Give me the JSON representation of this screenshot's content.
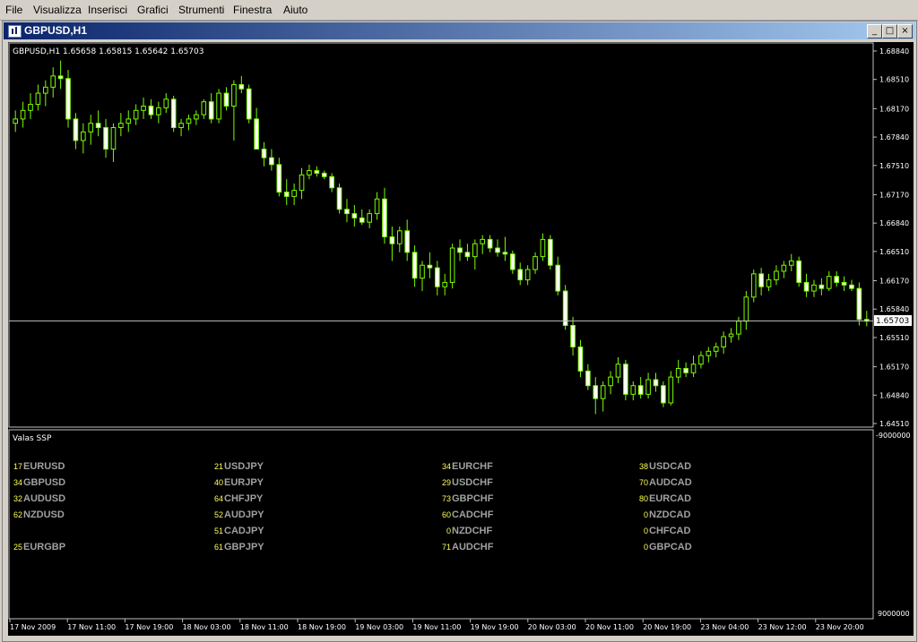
{
  "menu": {
    "items": [
      "File",
      "Visualizza",
      "Inserisci",
      "Grafici",
      "Strumenti",
      "Finestra",
      "Aiuto"
    ]
  },
  "window": {
    "title": "GBPUSD,H1",
    "icon": "chart-window-icon",
    "buttons": {
      "minimize": "_",
      "restore": "□",
      "close": "×"
    }
  },
  "chart": {
    "header": "GBPUSD,H1  1.65658 1.65815 1.65642 1.65703",
    "current_price_label": "1.65703",
    "price_ticks": [
      "1.68840",
      "1.68510",
      "1.68170",
      "1.67840",
      "1.67510",
      "1.67170",
      "1.66840",
      "1.66510",
      "1.66170",
      "1.65840",
      "1.65510",
      "1.65170",
      "1.64840",
      "1.64510"
    ],
    "time_ticks": [
      "17 Nov 2009",
      "17 Nov 11:00",
      "17 Nov 19:00",
      "18 Nov 03:00",
      "18 Nov 11:00",
      "18 Nov 19:00",
      "19 Nov 03:00",
      "19 Nov 11:00",
      "19 Nov 19:00",
      "20 Nov 03:00",
      "20 Nov 11:00",
      "20 Nov 19:00",
      "23 Nov 04:00",
      "23 Nov 12:00",
      "23 Nov 20:00"
    ],
    "colors": {
      "background": "#000000",
      "bull": "#7cfc00",
      "bear": "#ffffff",
      "grid": "#c0c0c0",
      "text": "#ffffff"
    }
  },
  "indicator": {
    "name": "Valas SSP",
    "scale_top": "-9000000",
    "scale_bottom": "9000000",
    "colors": {
      "value": "#ffff55",
      "pair": "#a0a0a0"
    },
    "columns": [
      [
        {
          "value": "17",
          "pair": "EURUSD"
        },
        {
          "value": "34",
          "pair": "GBPUSD"
        },
        {
          "value": "32",
          "pair": "AUDUSD"
        },
        {
          "value": "62",
          "pair": "NZDUSD"
        },
        {
          "value": "",
          "pair": ""
        },
        {
          "value": "25",
          "pair": "EURGBP"
        }
      ],
      [
        {
          "value": "21",
          "pair": "USDJPY"
        },
        {
          "value": "40",
          "pair": "EURJPY"
        },
        {
          "value": "64",
          "pair": "CHFJPY"
        },
        {
          "value": "52",
          "pair": "AUDJPY"
        },
        {
          "value": "51",
          "pair": "CADJPY"
        },
        {
          "value": "61",
          "pair": "GBPJPY"
        }
      ],
      [
        {
          "value": "34",
          "pair": "EURCHF"
        },
        {
          "value": "29",
          "pair": "USDCHF"
        },
        {
          "value": "73",
          "pair": "GBPCHF"
        },
        {
          "value": "60",
          "pair": "CADCHF"
        },
        {
          "value": "0",
          "pair": "NZDCHF"
        },
        {
          "value": "71",
          "pair": "AUDCHF"
        }
      ],
      [
        {
          "value": "38",
          "pair": "USDCAD"
        },
        {
          "value": "70",
          "pair": "AUDCAD"
        },
        {
          "value": "80",
          "pair": "EURCAD"
        },
        {
          "value": "0",
          "pair": "NZDCAD"
        },
        {
          "value": "0",
          "pair": "CHFCAD"
        },
        {
          "value": "0",
          "pair": "GBPCAD"
        }
      ]
    ]
  },
  "chart_data": {
    "type": "candlestick",
    "symbol": "GBPUSD",
    "timeframe": "H1",
    "ylim": [
      1.6451,
      1.6884
    ],
    "last_price": 1.65703,
    "candles": [
      {
        "o": 1.68,
        "h": 1.6815,
        "l": 1.679,
        "c": 1.6805
      },
      {
        "o": 1.6805,
        "h": 1.6825,
        "l": 1.6795,
        "c": 1.6815
      },
      {
        "o": 1.6815,
        "h": 1.6835,
        "l": 1.6805,
        "c": 1.6822
      },
      {
        "o": 1.6822,
        "h": 1.6845,
        "l": 1.6815,
        "c": 1.6835
      },
      {
        "o": 1.6835,
        "h": 1.685,
        "l": 1.682,
        "c": 1.6842
      },
      {
        "o": 1.6842,
        "h": 1.6865,
        "l": 1.683,
        "c": 1.6855
      },
      {
        "o": 1.6855,
        "h": 1.6873,
        "l": 1.684,
        "c": 1.6852
      },
      {
        "o": 1.6852,
        "h": 1.6862,
        "l": 1.6795,
        "c": 1.6805
      },
      {
        "o": 1.6805,
        "h": 1.6812,
        "l": 1.677,
        "c": 1.678
      },
      {
        "o": 1.678,
        "h": 1.68,
        "l": 1.6765,
        "c": 1.679
      },
      {
        "o": 1.679,
        "h": 1.681,
        "l": 1.6775,
        "c": 1.68
      },
      {
        "o": 1.68,
        "h": 1.6815,
        "l": 1.6785,
        "c": 1.6795
      },
      {
        "o": 1.6795,
        "h": 1.6805,
        "l": 1.676,
        "c": 1.677
      },
      {
        "o": 1.677,
        "h": 1.68,
        "l": 1.6755,
        "c": 1.6795
      },
      {
        "o": 1.6795,
        "h": 1.6812,
        "l": 1.6785,
        "c": 1.68
      },
      {
        "o": 1.68,
        "h": 1.6815,
        "l": 1.679,
        "c": 1.6805
      },
      {
        "o": 1.6805,
        "h": 1.6822,
        "l": 1.6798,
        "c": 1.6815
      },
      {
        "o": 1.6815,
        "h": 1.683,
        "l": 1.6805,
        "c": 1.682
      },
      {
        "o": 1.682,
        "h": 1.6828,
        "l": 1.6805,
        "c": 1.681
      },
      {
        "o": 1.681,
        "h": 1.6825,
        "l": 1.68,
        "c": 1.6818
      },
      {
        "o": 1.6818,
        "h": 1.6835,
        "l": 1.6812,
        "c": 1.6828
      },
      {
        "o": 1.6828,
        "h": 1.6832,
        "l": 1.679,
        "c": 1.6795
      },
      {
        "o": 1.6795,
        "h": 1.6805,
        "l": 1.6785,
        "c": 1.68
      },
      {
        "o": 1.68,
        "h": 1.681,
        "l": 1.6792,
        "c": 1.6805
      },
      {
        "o": 1.6805,
        "h": 1.6815,
        "l": 1.6798,
        "c": 1.681
      },
      {
        "o": 1.681,
        "h": 1.6828,
        "l": 1.6805,
        "c": 1.6825
      },
      {
        "o": 1.6825,
        "h": 1.6835,
        "l": 1.68,
        "c": 1.6805
      },
      {
        "o": 1.6805,
        "h": 1.684,
        "l": 1.68,
        "c": 1.6835
      },
      {
        "o": 1.6835,
        "h": 1.6842,
        "l": 1.6815,
        "c": 1.682
      },
      {
        "o": 1.682,
        "h": 1.685,
        "l": 1.678,
        "c": 1.6845
      },
      {
        "o": 1.6845,
        "h": 1.6855,
        "l": 1.6835,
        "c": 1.684
      },
      {
        "o": 1.684,
        "h": 1.6845,
        "l": 1.68,
        "c": 1.6805
      },
      {
        "o": 1.6805,
        "h": 1.6818,
        "l": 1.6775,
        "c": 1.677
      },
      {
        "o": 1.677,
        "h": 1.6778,
        "l": 1.675,
        "c": 1.676
      },
      {
        "o": 1.676,
        "h": 1.677,
        "l": 1.6745,
        "c": 1.6752
      },
      {
        "o": 1.6752,
        "h": 1.676,
        "l": 1.6715,
        "c": 1.672
      },
      {
        "o": 1.672,
        "h": 1.6735,
        "l": 1.6705,
        "c": 1.6715
      },
      {
        "o": 1.6715,
        "h": 1.673,
        "l": 1.6705,
        "c": 1.6722
      },
      {
        "o": 1.6722,
        "h": 1.6748,
        "l": 1.6712,
        "c": 1.674
      },
      {
        "o": 1.674,
        "h": 1.6752,
        "l": 1.6735,
        "c": 1.6745
      },
      {
        "o": 1.6745,
        "h": 1.675,
        "l": 1.6738,
        "c": 1.6742
      },
      {
        "o": 1.6742,
        "h": 1.6745,
        "l": 1.6735,
        "c": 1.6738
      },
      {
        "o": 1.6738,
        "h": 1.6742,
        "l": 1.672,
        "c": 1.6725
      },
      {
        "o": 1.6725,
        "h": 1.673,
        "l": 1.6695,
        "c": 1.67
      },
      {
        "o": 1.67,
        "h": 1.6712,
        "l": 1.6685,
        "c": 1.6695
      },
      {
        "o": 1.6695,
        "h": 1.6705,
        "l": 1.668,
        "c": 1.669
      },
      {
        "o": 1.669,
        "h": 1.67,
        "l": 1.6682,
        "c": 1.6685
      },
      {
        "o": 1.6685,
        "h": 1.67,
        "l": 1.6678,
        "c": 1.6695
      },
      {
        "o": 1.6695,
        "h": 1.672,
        "l": 1.6688,
        "c": 1.6712
      },
      {
        "o": 1.6712,
        "h": 1.6725,
        "l": 1.666,
        "c": 1.6668
      },
      {
        "o": 1.6668,
        "h": 1.668,
        "l": 1.664,
        "c": 1.666
      },
      {
        "o": 1.666,
        "h": 1.668,
        "l": 1.665,
        "c": 1.6675
      },
      {
        "o": 1.6675,
        "h": 1.6688,
        "l": 1.664,
        "c": 1.665
      },
      {
        "o": 1.665,
        "h": 1.6658,
        "l": 1.661,
        "c": 1.662
      },
      {
        "o": 1.662,
        "h": 1.664,
        "l": 1.6605,
        "c": 1.6635
      },
      {
        "o": 1.6635,
        "h": 1.665,
        "l": 1.662,
        "c": 1.6632
      },
      {
        "o": 1.6632,
        "h": 1.664,
        "l": 1.66,
        "c": 1.661
      },
      {
        "o": 1.661,
        "h": 1.6625,
        "l": 1.66,
        "c": 1.6615
      },
      {
        "o": 1.6615,
        "h": 1.666,
        "l": 1.6608,
        "c": 1.6655
      },
      {
        "o": 1.6655,
        "h": 1.6665,
        "l": 1.664,
        "c": 1.665
      },
      {
        "o": 1.665,
        "h": 1.666,
        "l": 1.664,
        "c": 1.6645
      },
      {
        "o": 1.6645,
        "h": 1.6665,
        "l": 1.663,
        "c": 1.666
      },
      {
        "o": 1.666,
        "h": 1.667,
        "l": 1.6648,
        "c": 1.6665
      },
      {
        "o": 1.6665,
        "h": 1.667,
        "l": 1.665,
        "c": 1.6655
      },
      {
        "o": 1.6655,
        "h": 1.6665,
        "l": 1.6645,
        "c": 1.665
      },
      {
        "o": 1.665,
        "h": 1.6668,
        "l": 1.664,
        "c": 1.6648
      },
      {
        "o": 1.6648,
        "h": 1.6652,
        "l": 1.6625,
        "c": 1.663
      },
      {
        "o": 1.663,
        "h": 1.6638,
        "l": 1.6612,
        "c": 1.6618
      },
      {
        "o": 1.6618,
        "h": 1.6635,
        "l": 1.6612,
        "c": 1.663
      },
      {
        "o": 1.663,
        "h": 1.665,
        "l": 1.6625,
        "c": 1.6645
      },
      {
        "o": 1.6645,
        "h": 1.6672,
        "l": 1.664,
        "c": 1.6665
      },
      {
        "o": 1.6665,
        "h": 1.667,
        "l": 1.663,
        "c": 1.6635
      },
      {
        "o": 1.6635,
        "h": 1.6645,
        "l": 1.66,
        "c": 1.6605
      },
      {
        "o": 1.6605,
        "h": 1.6612,
        "l": 1.656,
        "c": 1.6565
      },
      {
        "o": 1.6565,
        "h": 1.6575,
        "l": 1.653,
        "c": 1.654
      },
      {
        "o": 1.654,
        "h": 1.6548,
        "l": 1.6505,
        "c": 1.6512
      },
      {
        "o": 1.6512,
        "h": 1.652,
        "l": 1.649,
        "c": 1.6495
      },
      {
        "o": 1.6495,
        "h": 1.6505,
        "l": 1.6462,
        "c": 1.648
      },
      {
        "o": 1.648,
        "h": 1.65,
        "l": 1.6465,
        "c": 1.6495
      },
      {
        "o": 1.6495,
        "h": 1.6512,
        "l": 1.6485,
        "c": 1.6505
      },
      {
        "o": 1.6505,
        "h": 1.6528,
        "l": 1.6498,
        "c": 1.652
      },
      {
        "o": 1.652,
        "h": 1.6525,
        "l": 1.6478,
        "c": 1.6485
      },
      {
        "o": 1.6485,
        "h": 1.65,
        "l": 1.6478,
        "c": 1.6495
      },
      {
        "o": 1.6495,
        "h": 1.6505,
        "l": 1.648,
        "c": 1.6485
      },
      {
        "o": 1.6485,
        "h": 1.651,
        "l": 1.648,
        "c": 1.6502
      },
      {
        "o": 1.6502,
        "h": 1.651,
        "l": 1.6488,
        "c": 1.6495
      },
      {
        "o": 1.6495,
        "h": 1.65,
        "l": 1.647,
        "c": 1.6475
      },
      {
        "o": 1.6475,
        "h": 1.6512,
        "l": 1.6472,
        "c": 1.6505
      },
      {
        "o": 1.6505,
        "h": 1.6525,
        "l": 1.6498,
        "c": 1.6515
      },
      {
        "o": 1.6515,
        "h": 1.6522,
        "l": 1.6505,
        "c": 1.651
      },
      {
        "o": 1.651,
        "h": 1.653,
        "l": 1.6505,
        "c": 1.652
      },
      {
        "o": 1.652,
        "h": 1.6535,
        "l": 1.6515,
        "c": 1.653
      },
      {
        "o": 1.653,
        "h": 1.654,
        "l": 1.6522,
        "c": 1.6535
      },
      {
        "o": 1.6535,
        "h": 1.6545,
        "l": 1.6528,
        "c": 1.654
      },
      {
        "o": 1.654,
        "h": 1.6558,
        "l": 1.6532,
        "c": 1.6552
      },
      {
        "o": 1.6552,
        "h": 1.6562,
        "l": 1.6545,
        "c": 1.6555
      },
      {
        "o": 1.6555,
        "h": 1.6575,
        "l": 1.6548,
        "c": 1.657
      },
      {
        "o": 1.657,
        "h": 1.6605,
        "l": 1.656,
        "c": 1.6598
      },
      {
        "o": 1.6598,
        "h": 1.663,
        "l": 1.6592,
        "c": 1.6625
      },
      {
        "o": 1.6625,
        "h": 1.6632,
        "l": 1.66,
        "c": 1.661
      },
      {
        "o": 1.661,
        "h": 1.6625,
        "l": 1.6605,
        "c": 1.6618
      },
      {
        "o": 1.6618,
        "h": 1.6635,
        "l": 1.6612,
        "c": 1.6628
      },
      {
        "o": 1.6628,
        "h": 1.664,
        "l": 1.662,
        "c": 1.6635
      },
      {
        "o": 1.6635,
        "h": 1.6648,
        "l": 1.6628,
        "c": 1.664
      },
      {
        "o": 1.664,
        "h": 1.6645,
        "l": 1.661,
        "c": 1.6615
      },
      {
        "o": 1.6615,
        "h": 1.6625,
        "l": 1.6598,
        "c": 1.6605
      },
      {
        "o": 1.6605,
        "h": 1.6618,
        "l": 1.6598,
        "c": 1.6612
      },
      {
        "o": 1.6612,
        "h": 1.662,
        "l": 1.66,
        "c": 1.6608
      },
      {
        "o": 1.6608,
        "h": 1.6628,
        "l": 1.6605,
        "c": 1.6622
      },
      {
        "o": 1.6622,
        "h": 1.6628,
        "l": 1.661,
        "c": 1.6615
      },
      {
        "o": 1.6615,
        "h": 1.6622,
        "l": 1.6605,
        "c": 1.6612
      },
      {
        "o": 1.6612,
        "h": 1.6618,
        "l": 1.6605,
        "c": 1.6608
      },
      {
        "o": 1.6608,
        "h": 1.6615,
        "l": 1.6565,
        "c": 1.6572
      },
      {
        "o": 1.6572,
        "h": 1.6582,
        "l": 1.6564,
        "c": 1.657
      }
    ]
  }
}
